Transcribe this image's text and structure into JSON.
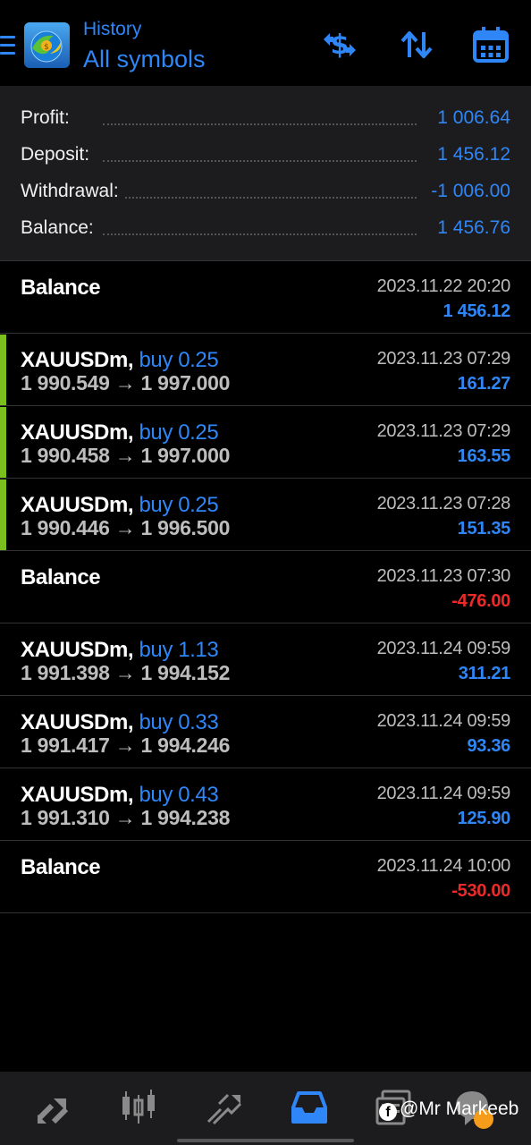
{
  "header": {
    "subtitle": "History",
    "title": "All symbols",
    "icons": [
      "menu-icon",
      "app-logo-icon",
      "dollar-swap-icon",
      "sort-icon",
      "calendar-icon"
    ]
  },
  "summary": {
    "profit": {
      "label": "Profit:",
      "value": "1 006.64"
    },
    "deposit": {
      "label": "Deposit:",
      "value": "1 456.12"
    },
    "withdrawal": {
      "label": "Withdrawal:",
      "value": "-1 006.00"
    },
    "balance": {
      "label": "Balance:",
      "value": "1 456.76"
    }
  },
  "rows": [
    {
      "kind": "balance",
      "title": "Balance",
      "date": "2023.11.22 20:20",
      "amount": "1 456.12",
      "sign": "pos"
    },
    {
      "kind": "trade",
      "symbol": "XAUUSDm,",
      "side": "buy 0.25",
      "prices": "1 990.549 → 1 997.000",
      "date": "2023.11.23 07:29",
      "amount": "161.27",
      "sign": "pos"
    },
    {
      "kind": "trade",
      "symbol": "XAUUSDm,",
      "side": "buy 0.25",
      "prices": "1 990.458 → 1 997.000",
      "date": "2023.11.23 07:29",
      "amount": "163.55",
      "sign": "pos"
    },
    {
      "kind": "trade",
      "symbol": "XAUUSDm,",
      "side": "buy 0.25",
      "prices": "1 990.446 → 1 996.500",
      "date": "2023.11.23 07:28",
      "amount": "151.35",
      "sign": "pos"
    },
    {
      "kind": "balance",
      "title": "Balance",
      "date": "2023.11.23 07:30",
      "amount": "-476.00",
      "sign": "neg"
    },
    {
      "kind": "trade",
      "symbol": "XAUUSDm,",
      "side": "buy 1.13",
      "prices": "1 991.398 → 1 994.152",
      "date": "2023.11.24 09:59",
      "amount": "311.21",
      "sign": "pos"
    },
    {
      "kind": "trade",
      "symbol": "XAUUSDm,",
      "side": "buy 0.33",
      "prices": "1 991.417 → 1 994.246",
      "date": "2023.11.24 09:59",
      "amount": "93.36",
      "sign": "pos"
    },
    {
      "kind": "trade",
      "symbol": "XAUUSDm,",
      "side": "buy 0.43",
      "prices": "1 991.310 → 1 994.238",
      "date": "2023.11.24 09:59",
      "amount": "125.90",
      "sign": "pos"
    },
    {
      "kind": "balance",
      "title": "Balance",
      "date": "2023.11.24 10:00",
      "amount": "-530.00",
      "sign": "neg"
    }
  ],
  "bottom_nav": {
    "items": [
      "quotes-icon",
      "chart-icon",
      "trade-icon",
      "history-icon",
      "messages-icon",
      "community-icon"
    ],
    "active": "history-icon"
  },
  "watermark": {
    "logo_letter": "f",
    "text": "@Mr Markeeb"
  },
  "colors": {
    "accent": "#2f86f6",
    "negative": "#ec2a2a",
    "marker": "#7bbf1e",
    "panel": "#1c1c1e"
  }
}
